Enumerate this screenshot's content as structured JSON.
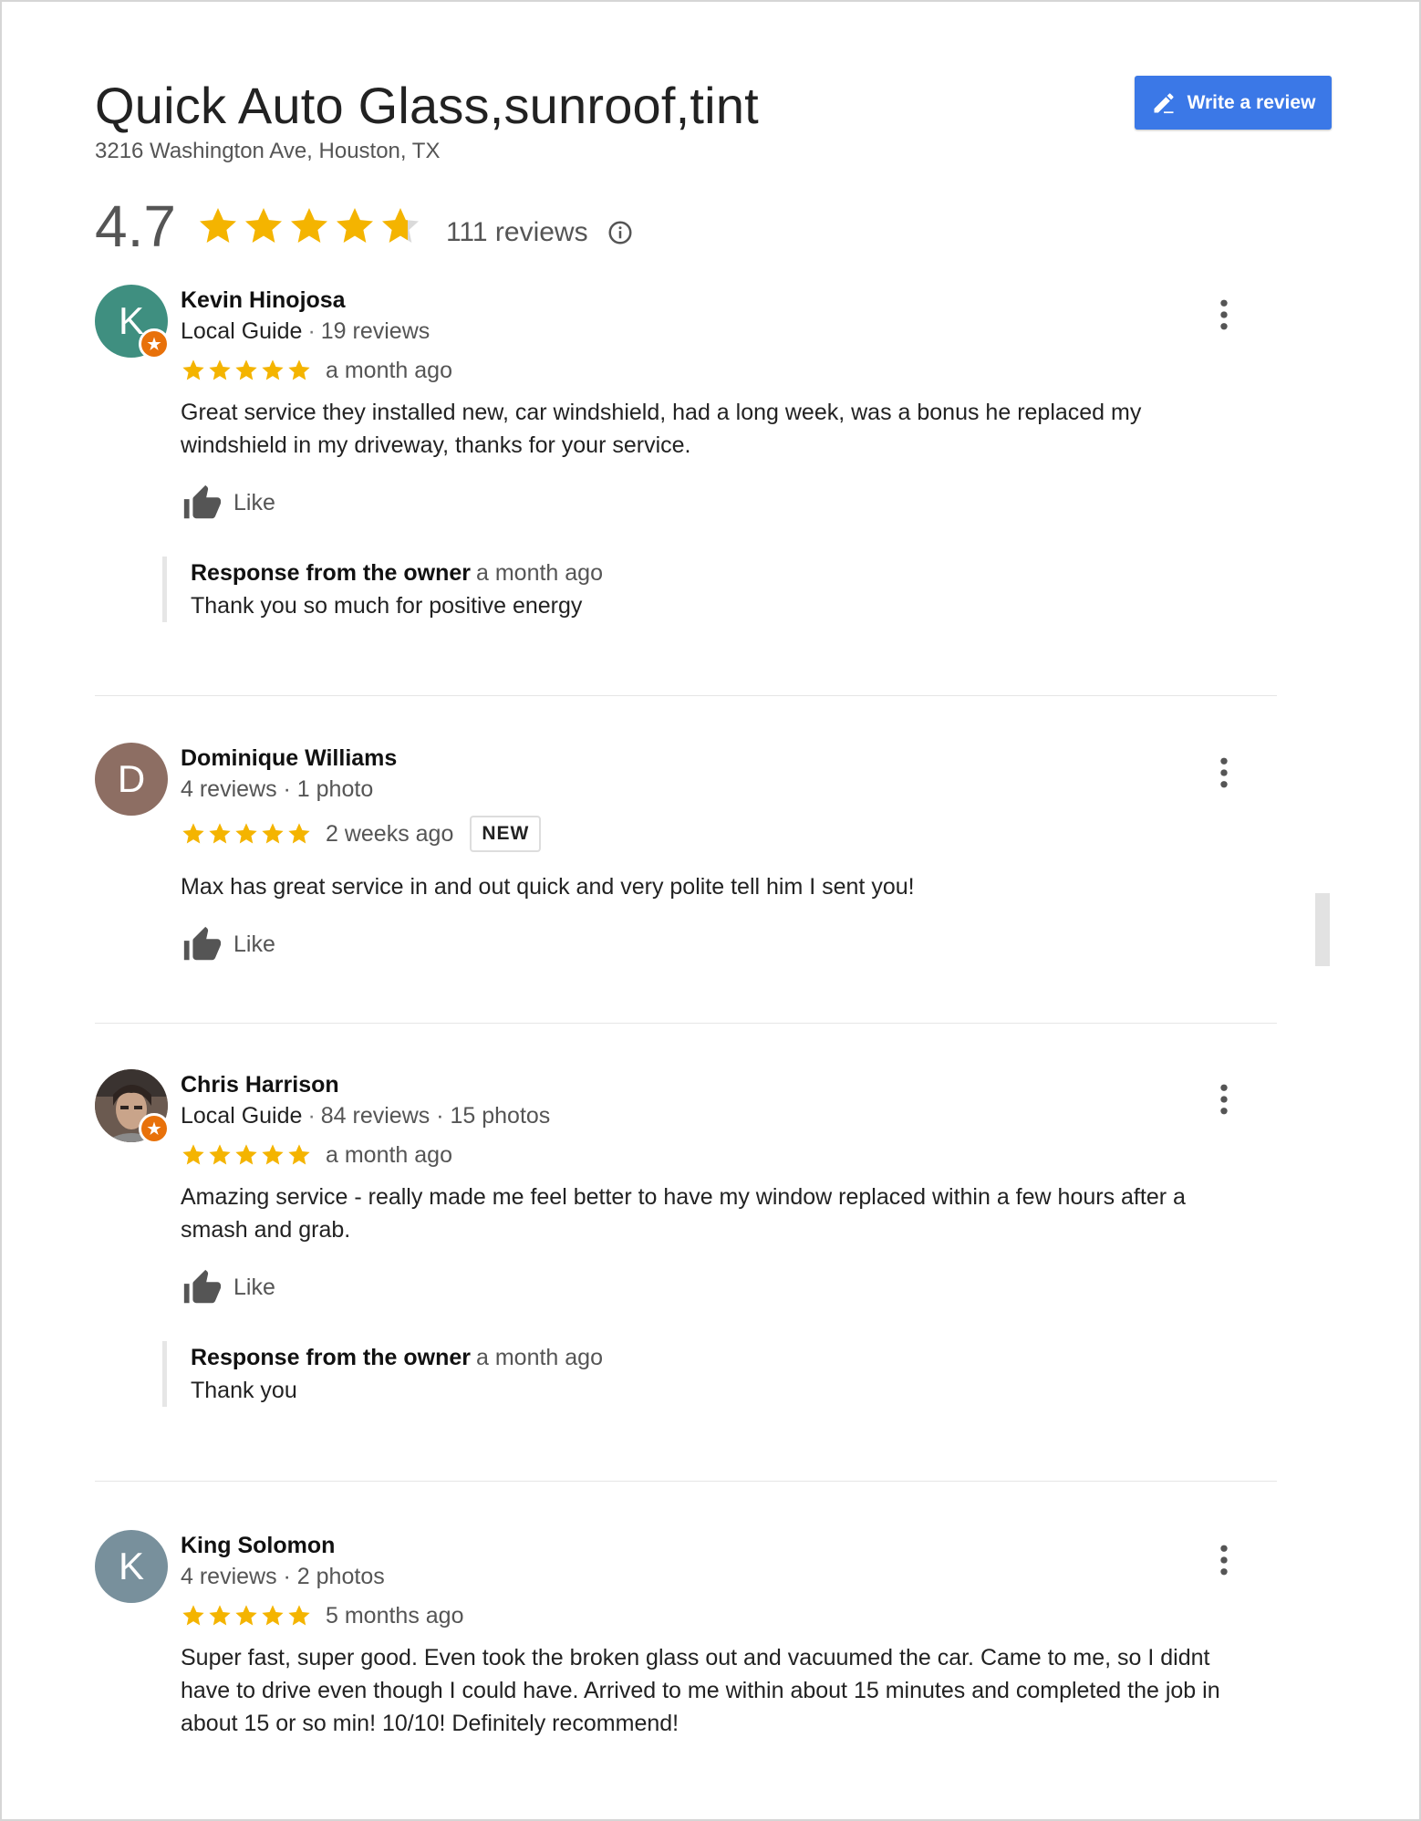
{
  "business": {
    "title": "Quick Auto Glass,sunroof,tint",
    "address": "3216 Washington Ave, Houston, TX",
    "write_review_label": "Write a review",
    "rating": "4.7",
    "rating_value": 4.7,
    "review_count": "111 reviews"
  },
  "colors": {
    "star": "#f4b400",
    "button": "#3b78e7",
    "local_guide_badge": "#e8710a"
  },
  "icons": {
    "write": "pencil-icon",
    "info": "info-icon",
    "like": "thumb-up-icon",
    "more": "more-vert-icon",
    "guide": "local-guide-badge-icon"
  },
  "reviews": [
    {
      "avatar_letter": "K",
      "avatar_color": "#3f8f80",
      "local_guide": true,
      "name": "Kevin Hinojosa",
      "meta_prefix": "Local Guide",
      "meta": "19 reviews",
      "stars": 5,
      "time": "a month ago",
      "text": "Great service they installed new, car windshield, had a long week, was a bonus he replaced my windshield in my driveway, thanks for your service.",
      "like_label": "Like",
      "response_label": "Response from the owner",
      "response_time": "a month ago",
      "response_text": "Thank you so much for positive energy"
    },
    {
      "avatar_letter": "D",
      "avatar_color": "#8d6e63",
      "local_guide": false,
      "name": "Dominique Williams",
      "meta": "4 reviews · 1 photo",
      "stars": 5,
      "time": "2 weeks ago",
      "badge": "NEW",
      "text": "Max has great service in and out quick and very polite tell him I sent you!",
      "like_label": "Like"
    },
    {
      "avatar_letter": "",
      "avatar_color": "#5a4a42",
      "local_guide": true,
      "name": "Chris Harrison",
      "meta_prefix": "Local Guide",
      "meta": "84 reviews · 15 photos",
      "stars": 5,
      "time": "a month ago",
      "text": "Amazing service - really made me feel better to have my window replaced within a few hours after a smash and grab.",
      "like_label": "Like",
      "response_label": "Response from the owner",
      "response_time": "a month ago",
      "response_text": "Thank you"
    },
    {
      "avatar_letter": "K",
      "avatar_color": "#78909c",
      "local_guide": false,
      "name": "King Solomon",
      "meta": "4 reviews · 2 photos",
      "stars": 5,
      "time": "5 months ago",
      "text": "Super fast, super good. Even took the broken glass out and vacuumed the car. Came to me, so I didnt have to drive even though I could have. Arrived to me within about 15 minutes and completed the job in about 15 or so min! 10/10! Definitely recommend!"
    }
  ]
}
